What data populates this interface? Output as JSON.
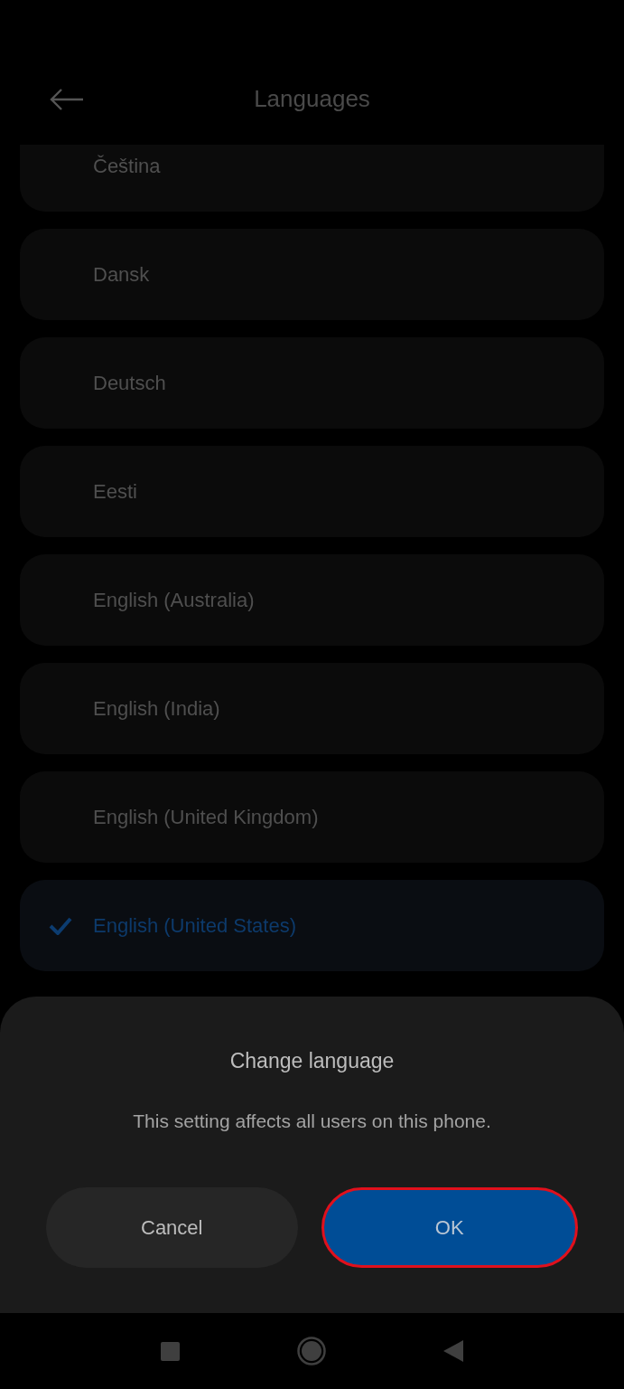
{
  "header": {
    "title": "Languages"
  },
  "languages": [
    {
      "label": "Čeština",
      "selected": false
    },
    {
      "label": "Dansk",
      "selected": false
    },
    {
      "label": "Deutsch",
      "selected": false
    },
    {
      "label": "Eesti",
      "selected": false
    },
    {
      "label": "English (Australia)",
      "selected": false
    },
    {
      "label": "English (India)",
      "selected": false
    },
    {
      "label": "English (United Kingdom)",
      "selected": false
    },
    {
      "label": "English (United States)",
      "selected": true
    }
  ],
  "dialog": {
    "title": "Change language",
    "message": "This setting affects all users on this phone.",
    "buttons": [
      {
        "label": "Cancel",
        "kind": "secondary",
        "highlighted": false
      },
      {
        "label": "OK",
        "kind": "primary",
        "highlighted": true
      }
    ]
  }
}
